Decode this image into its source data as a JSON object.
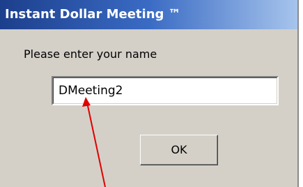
{
  "window": {
    "title": "Instant Dollar Meeting ™"
  },
  "dialog": {
    "prompt": "Please enter your name",
    "name_value": "DMeeting2",
    "ok_label": "OK"
  },
  "colors": {
    "annotation_arrow": "#e00000",
    "title_bar": "#1c3f8c"
  },
  "annotation": {
    "type": "arrow",
    "points_to": "name-input"
  }
}
